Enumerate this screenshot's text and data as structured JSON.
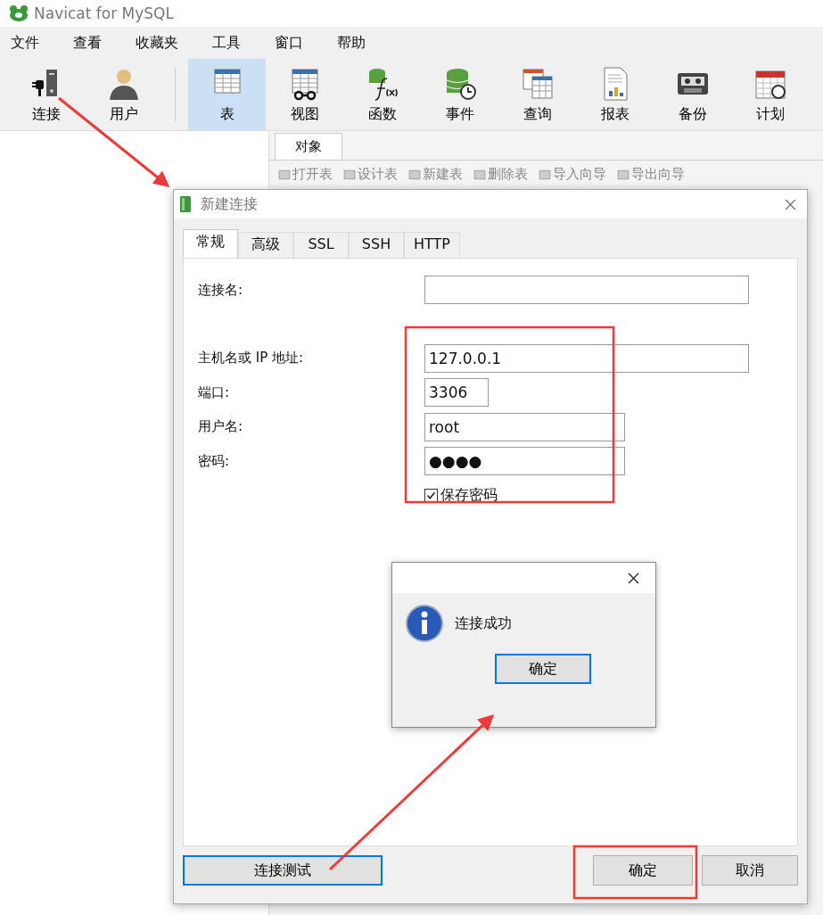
{
  "window": {
    "title": "Navicat for MySQL"
  },
  "menu": [
    "文件",
    "查看",
    "收藏夹",
    "工具",
    "窗口",
    "帮助"
  ],
  "toolbar": [
    {
      "label": "连接",
      "kind": "connect",
      "selected": false
    },
    {
      "label": "用户",
      "kind": "user",
      "selected": false
    },
    {
      "label": "表",
      "kind": "table",
      "selected": true
    },
    {
      "label": "视图",
      "kind": "view",
      "selected": false
    },
    {
      "label": "函数",
      "kind": "function",
      "selected": false
    },
    {
      "label": "事件",
      "kind": "event",
      "selected": false
    },
    {
      "label": "查询",
      "kind": "query",
      "selected": false
    },
    {
      "label": "报表",
      "kind": "report",
      "selected": false
    },
    {
      "label": "备份",
      "kind": "backup",
      "selected": false
    },
    {
      "label": "计划",
      "kind": "schedule",
      "selected": false
    }
  ],
  "object_tab": "对象",
  "object_toolbar": [
    "打开表",
    "设计表",
    "新建表",
    "删除表",
    "导入向导",
    "导出向导"
  ],
  "dialog": {
    "title": "新建连接",
    "tabs": [
      {
        "label": "常规",
        "selected": true
      },
      {
        "label": "高级",
        "selected": false
      },
      {
        "label": "SSL",
        "selected": false
      },
      {
        "label": "SSH",
        "selected": false
      },
      {
        "label": "HTTP",
        "selected": false
      }
    ],
    "name_field": {
      "label": "连接名:"
    },
    "fields": [
      {
        "label": "主机名或 IP 地址:",
        "value": "127.0.0.1"
      },
      {
        "label": "端口:",
        "value": "3306"
      },
      {
        "label": "用户名:",
        "value": "root"
      },
      {
        "label": "密码:",
        "value": "●●●●"
      }
    ],
    "save_password": {
      "label": "保存密码",
      "checked": true
    },
    "buttons": [
      {
        "label": "连接测试",
        "focused": true
      },
      {
        "label": "确定",
        "focused": false
      },
      {
        "label": "取消",
        "focused": false
      }
    ]
  },
  "message_box": {
    "text": "连接成功",
    "button": "确定"
  }
}
